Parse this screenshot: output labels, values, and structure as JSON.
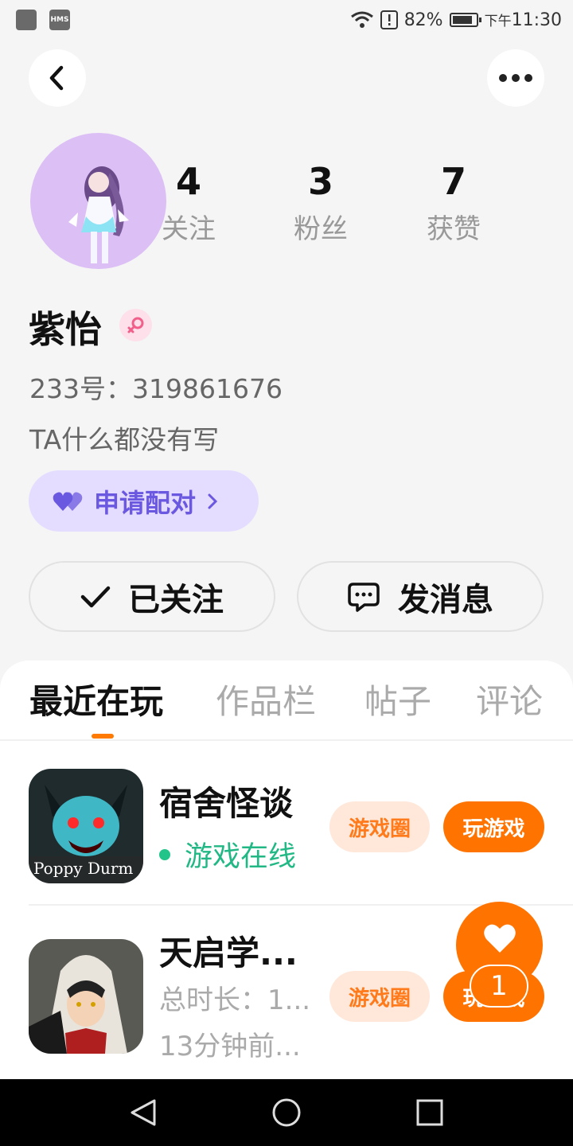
{
  "status_bar": {
    "notif_app_label": "HMS",
    "battery": "82%",
    "time_prefix": "下午",
    "time": "11:30"
  },
  "header": {
    "back_icon": "chevron-left-icon",
    "more_icon": "more-dots-icon"
  },
  "profile": {
    "stats": [
      {
        "value": "4",
        "label": "关注"
      },
      {
        "value": "3",
        "label": "粉丝"
      },
      {
        "value": "7",
        "label": "获赞"
      }
    ],
    "name": "紫怡",
    "gender_icon": "female-icon",
    "uid": "233号：319861676",
    "bio": "TA什么都没有写",
    "pair_button": "申请配对",
    "follow_button": "已关注",
    "message_button": "发消息"
  },
  "tabs": [
    "最近在玩",
    "作品栏",
    "帖子",
    "评论"
  ],
  "games": [
    {
      "name": "宿舍怪谈",
      "status": "游戏在线",
      "icon_text": "Poppy Durm",
      "circle_label": "游戏圈",
      "play_label": "玩游戏"
    },
    {
      "name": "天启学...",
      "total_time": "总时长：1...",
      "last_played": "13分钟前...",
      "circle_label": "游戏圈",
      "play_label": "玩游戏"
    }
  ],
  "fab": {
    "icon": "heart-icon",
    "badge": "1"
  },
  "colors": {
    "accent": "#ff7300",
    "pair_bg": "#e5ddff",
    "pair_text": "#6a58e0",
    "online": "#22b886"
  }
}
